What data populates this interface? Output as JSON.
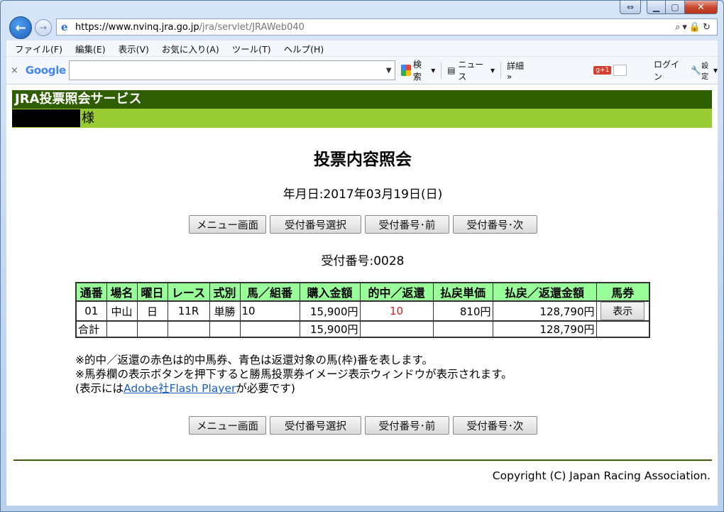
{
  "browser": {
    "url_host": "https://www.nvinq.jra.go.jp",
    "url_path": "/jra/servlet/JRAWeb040",
    "menu": [
      "ファイル(F)",
      "編集(E)",
      "表示(V)",
      "お気に入り(A)",
      "ツール(T)",
      "ヘルプ(H)"
    ],
    "google_toolbar": {
      "logo": "Google",
      "search_label": "検索",
      "news_label": "ニュース",
      "details_label": "詳細 »",
      "gplus": "g+1",
      "login": "ログイン",
      "settings": "設定"
    }
  },
  "page": {
    "service_title": "JRA投票照会サービス",
    "user_suffix": "様",
    "heading": "投票内容照会",
    "date_line": "年月日:2017年03月19日(日)",
    "buttons": [
      "メニュー画面",
      "受付番号選択",
      "受付番号･前",
      "受付番号･次"
    ],
    "receipt_line": "受付番号:0028",
    "table": {
      "headers": [
        "通番",
        "場名",
        "曜日",
        "レース",
        "式別",
        "馬／組番",
        "購入金額",
        "的中／返還",
        "払戻単価",
        "払戻／返還金額",
        "馬券"
      ],
      "row": {
        "seq": "01",
        "venue": "中山",
        "day": "日",
        "race": "11R",
        "bet_type": "単勝",
        "combo": "10",
        "amount": "15,900円",
        "hit": "10",
        "unit_payout": "810円",
        "payout": "128,790円",
        "ticket_button": "表示"
      },
      "total": {
        "label": "合計",
        "amount": "15,900円",
        "payout": "128,790円"
      }
    },
    "notes": [
      "※的中／返還の赤色は的中馬券、青色は返還対象の馬(枠)番を表します。",
      "※馬券欄の表示ボタンを押下すると勝馬投票券イメージ表示ウィンドウが表示されます。"
    ],
    "note3_pre": "(表示には",
    "note3_link": "Adobe社Flash Player",
    "note3_post": "が必要です)",
    "copyright": "Copyright (C) Japan Racing Association."
  },
  "colors": {
    "header_dark": "#2f5e00",
    "header_light": "#99cc33",
    "table_head": "#99ff99",
    "hit_red": "#d62020"
  }
}
